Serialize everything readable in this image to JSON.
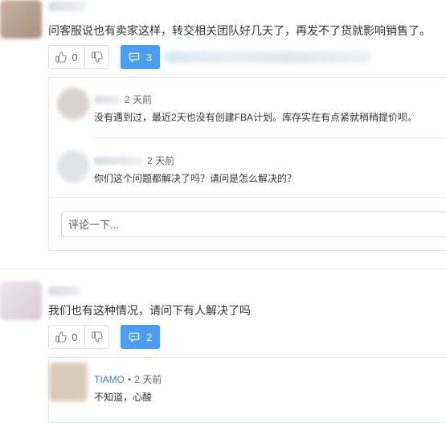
{
  "comment1": {
    "text": "问客服说也有卖家这样，转交相关团队好几天了，再发不了货就影响销售了。",
    "likes": "0",
    "replies_count": "3",
    "thread": {
      "replies": [
        {
          "time": "2 天前",
          "text": "没有遇到过，最近2天也没有创建FBA计划。库存实在有点紧就稍稍提价呗。"
        },
        {
          "time": "2 天前",
          "text": "你们这个问题都解决了吗？请问是怎么解决的？"
        }
      ],
      "input_placeholder": "评论一下..."
    }
  },
  "comment2": {
    "text": "我们也有这种情况，请问下有人解决了吗",
    "likes": "0",
    "replies_count": "2",
    "thread": {
      "replies": [
        {
          "author": "TIAMO",
          "time": "2 天前",
          "text": "不知道，心酸"
        }
      ]
    }
  },
  "icons": {
    "like": "thumbs-up-icon",
    "dislike": "thumbs-down-icon",
    "reply": "comment-bubble-icon"
  },
  "colors": {
    "reply_button": "#4b9cf5",
    "author_link": "#4a78c7"
  }
}
